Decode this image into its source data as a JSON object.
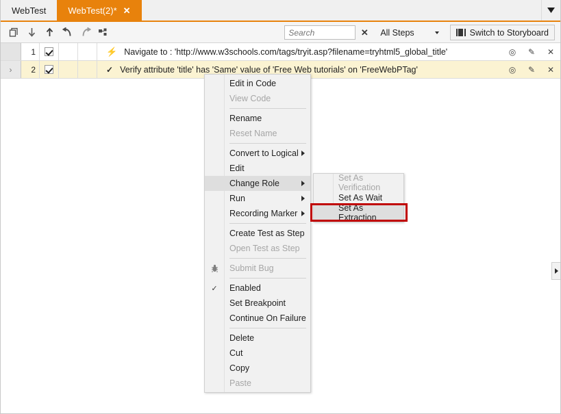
{
  "window": {
    "tabs": [
      {
        "label": "WebTest",
        "active": false,
        "close_icon": ""
      },
      {
        "label": "WebTest(2)*",
        "active": true,
        "close_icon": "✕"
      }
    ],
    "tab_dropdown_icon": "tab-list-dropdown-icon"
  },
  "toolbar": {
    "buttons": [
      {
        "name": "copy-step-button",
        "icon": "copy-icon"
      },
      {
        "name": "move-down-button",
        "icon": "arrow-down-icon"
      },
      {
        "name": "move-up-button",
        "icon": "arrow-up-icon"
      },
      {
        "name": "undo-button",
        "icon": "undo-icon"
      },
      {
        "name": "redo-button",
        "icon": "redo-icon"
      },
      {
        "name": "insert-step-button",
        "icon": "insert-step-icon"
      }
    ],
    "search": {
      "value": "",
      "placeholder": "Search"
    },
    "clear_search_label": "✕",
    "filter_label": "All Steps",
    "storyboard_label": "Switch to Storyboard"
  },
  "grid": {
    "rows": [
      {
        "indicator": "",
        "number": "1",
        "checked": true,
        "type_icon": "⚡",
        "type_icon_name": "lightning-bolt-icon",
        "text": "Navigate to : 'http://www.w3schools.com/tags/tryit.asp?filename=tryhtml5_global_title'",
        "selected": false
      },
      {
        "indicator": "›",
        "number": "2",
        "checked": true,
        "type_icon": "✓",
        "type_icon_name": "checkmark-icon",
        "text": "Verify attribute 'title' has 'Same' value of 'Free Web tutorials' on 'FreeWebPTag'",
        "selected": true
      }
    ],
    "row_actions": [
      {
        "name": "record-step-icon",
        "label": "◎"
      },
      {
        "name": "edit-step-icon",
        "label": "✎"
      },
      {
        "name": "delete-step-icon",
        "label": "✕"
      }
    ]
  },
  "context_menu": {
    "items": [
      {
        "label": "Edit in Code",
        "disabled": false,
        "submenu": false,
        "glyph": "",
        "highlight": false
      },
      {
        "label": "View Code",
        "disabled": true,
        "submenu": false,
        "glyph": "",
        "highlight": false
      },
      {
        "separator": true
      },
      {
        "label": "Rename",
        "disabled": false,
        "submenu": false,
        "glyph": "",
        "highlight": false
      },
      {
        "label": "Reset Name",
        "disabled": true,
        "submenu": false,
        "glyph": "",
        "highlight": false
      },
      {
        "separator": true
      },
      {
        "label": "Convert to Logical",
        "disabled": false,
        "submenu": true,
        "glyph": "",
        "highlight": false
      },
      {
        "label": "Edit",
        "disabled": false,
        "submenu": false,
        "glyph": "",
        "highlight": false
      },
      {
        "label": "Change Role",
        "disabled": false,
        "submenu": true,
        "glyph": "",
        "highlight": true
      },
      {
        "label": "Run",
        "disabled": false,
        "submenu": true,
        "glyph": "",
        "highlight": false
      },
      {
        "label": "Recording Marker",
        "disabled": false,
        "submenu": true,
        "glyph": "",
        "highlight": false
      },
      {
        "separator": true
      },
      {
        "label": "Create Test as Step",
        "disabled": false,
        "submenu": false,
        "glyph": "",
        "highlight": false
      },
      {
        "label": "Open Test as Step",
        "disabled": true,
        "submenu": false,
        "glyph": "",
        "highlight": false
      },
      {
        "separator": true
      },
      {
        "label": "Submit Bug",
        "disabled": true,
        "submenu": false,
        "glyph": "bug-icon",
        "highlight": false
      },
      {
        "separator": true
      },
      {
        "label": "Enabled",
        "disabled": false,
        "submenu": false,
        "glyph": "✓",
        "highlight": false
      },
      {
        "label": "Set Breakpoint",
        "disabled": false,
        "submenu": false,
        "glyph": "",
        "highlight": false
      },
      {
        "label": "Continue On Failure",
        "disabled": false,
        "submenu": false,
        "glyph": "",
        "highlight": false
      },
      {
        "separator": true
      },
      {
        "label": "Delete",
        "disabled": false,
        "submenu": false,
        "glyph": "",
        "highlight": false
      },
      {
        "label": "Cut",
        "disabled": false,
        "submenu": false,
        "glyph": "",
        "highlight": false
      },
      {
        "label": "Copy",
        "disabled": false,
        "submenu": false,
        "glyph": "",
        "highlight": false
      },
      {
        "label": "Paste",
        "disabled": true,
        "submenu": false,
        "glyph": "",
        "highlight": false
      }
    ]
  },
  "submenu": {
    "items": [
      {
        "label": "Set As Verification",
        "disabled": true,
        "highlight": false
      },
      {
        "label": "Set As Wait",
        "disabled": false,
        "highlight": false
      },
      {
        "label": "Set As Extraction",
        "disabled": false,
        "highlight": true
      }
    ]
  },
  "annotation": {
    "color": "#c00000",
    "target": "Set As Extraction"
  },
  "colors": {
    "accent_orange": "#e8820c",
    "selected_row": "#fbf3d2",
    "menu_bg": "#f1f1f1",
    "menu_highlight": "#dedede",
    "annotation_red": "#c00000"
  }
}
